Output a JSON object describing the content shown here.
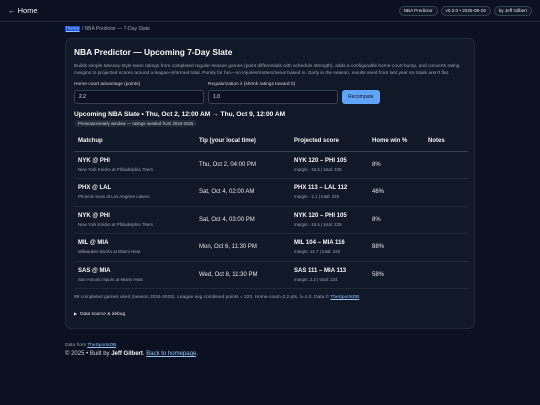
{
  "nav": {
    "home": "← Home",
    "badges": [
      "NBA Predictor",
      "v0.3.0 • 2025-08-19",
      "by Jeff Gilbert"
    ]
  },
  "breadcrumb": {
    "home": "Home",
    "sep": " / ",
    "current": "NBA Predictor — 7-Day Slate"
  },
  "card": {
    "title": "NBA Predictor — Upcoming 7-Day Slate",
    "intro_before": "Builds simple ",
    "intro_em": "Massey",
    "intro_after": "-style team ratings from completed regular-season games (point differentials with schedule strength), adds a configurable home-court bump, and converts rating margins to projected scores around a league-informed total. Purely for fun—no injuries/rosters/news baked in. Early in the season, results seed from last year so totals aren't flat.",
    "hca_label": "Home-court advantage (points)",
    "hca_value": "2.2",
    "reg_label": "Regularization λ (shrink ratings toward 0)",
    "reg_value": "1.0",
    "recompute": "Recompute",
    "slate_title": "Upcoming NBA Slate • Thu, Oct 2, 12:00 AM → Thu, Oct 9, 12:00 AM",
    "chip": "Preseason/early window — ratings seeded from 2024-2025"
  },
  "table": {
    "headers": [
      "Matchup",
      "Tip (your local time)",
      "Projected score",
      "Home win %",
      "Notes"
    ],
    "rows": [
      {
        "matchup": "NYK @ PHI",
        "teams": "New York Knicks at Philadelphia 76ers",
        "tip": "Thu, Oct 2, 04:00 PM",
        "score": "NYK 120 – PHI 105",
        "meta": "margin: -15.5 | total: 225",
        "win": "8%",
        "notes": ""
      },
      {
        "matchup": "PHX @ LAL",
        "teams": "Phoenix Suns at Los Angeles Lakers",
        "tip": "Sat, Oct 4, 02:00 AM",
        "score": "PHX 113 – LAL 112",
        "meta": "margin: -1.1 | total: 225",
        "win": "46%",
        "notes": ""
      },
      {
        "matchup": "NYK @ PHI",
        "teams": "New York Knicks at Philadelphia 76ers",
        "tip": "Sat, Oct 4, 03:00 PM",
        "score": "NYK 120 – PHI 105",
        "meta": "margin: -15.5 | total: 225",
        "win": "8%",
        "notes": ""
      },
      {
        "matchup": "MIL @ MIA",
        "teams": "Milwaukee Bucks at Miami Heat",
        "tip": "Mon, Oct 6, 11:30 PM",
        "score": "MIL 104 – MIA 116",
        "meta": "margin: 12.7 | total: 220",
        "win": "88%",
        "notes": ""
      },
      {
        "matchup": "SAS @ MIA",
        "teams": "San Antonio Spurs at Miami Heat",
        "tip": "Wed, Oct 8, 11:30 PM",
        "score": "SAS 111 – MIA 113",
        "meta": "margin: 2.2 | total: 224",
        "win": "58%",
        "notes": ""
      }
    ]
  },
  "footnote": {
    "text": "99 completed games used (season 2024-2025). League avg combined points = 223. Home-court=2.2 pts, λ=1.0. Data © ",
    "link": "TheSportsDB"
  },
  "debug": {
    "label": "Data source & debug"
  },
  "footer": {
    "src_prefix": "Data from ",
    "src_link": "TheSportsDB",
    "src_suffix": ".",
    "copy_prefix": "© 2025 • Built by ",
    "copy_author": "Jeff Gilbert",
    "copy_mid": ". ",
    "copy_link": "Back to homepage",
    "copy_suffix": "."
  }
}
